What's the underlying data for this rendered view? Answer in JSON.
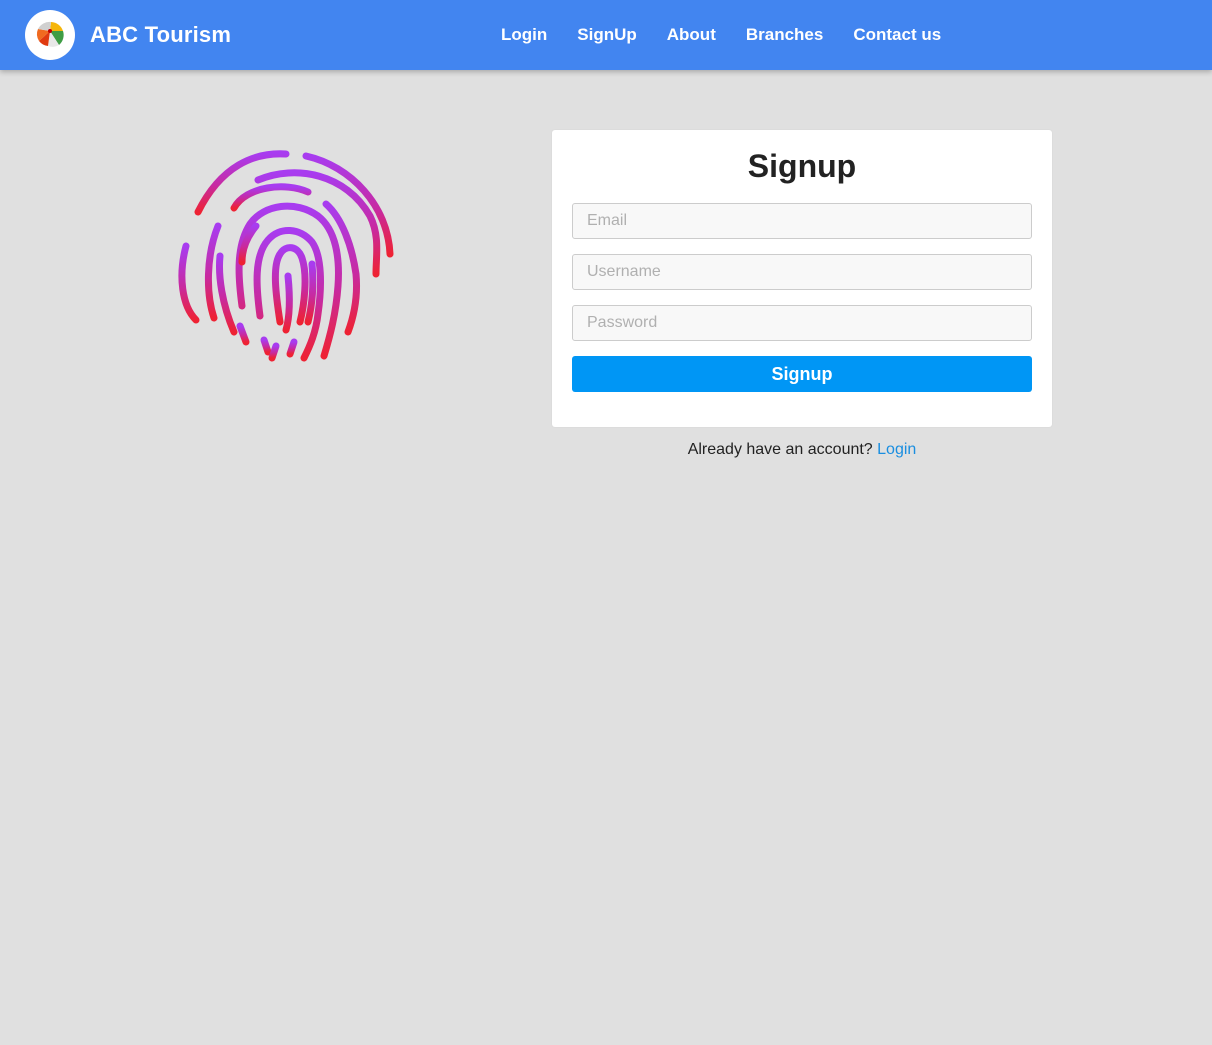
{
  "brand": {
    "name": "ABC Tourism",
    "logo_icon": "beach-umbrella-icon"
  },
  "nav": {
    "items": [
      {
        "label": "Login"
      },
      {
        "label": "SignUp"
      },
      {
        "label": "About"
      },
      {
        "label": "Branches"
      },
      {
        "label": "Contact us"
      }
    ]
  },
  "hero": {
    "icon": "fingerprint-icon"
  },
  "form": {
    "title": "Signup",
    "email_placeholder": "Email",
    "username_placeholder": "Username",
    "password_placeholder": "Password",
    "submit_label": "Signup"
  },
  "footer": {
    "prompt": "Already have an account?",
    "link_label": "Login"
  },
  "colors": {
    "navbar": "#4285f0",
    "background": "#e0e0e0",
    "button": "#0096f5",
    "link": "#1a8ee0",
    "fingerprint_top": "#a83cf0",
    "fingerprint_bottom": "#ee2233"
  }
}
